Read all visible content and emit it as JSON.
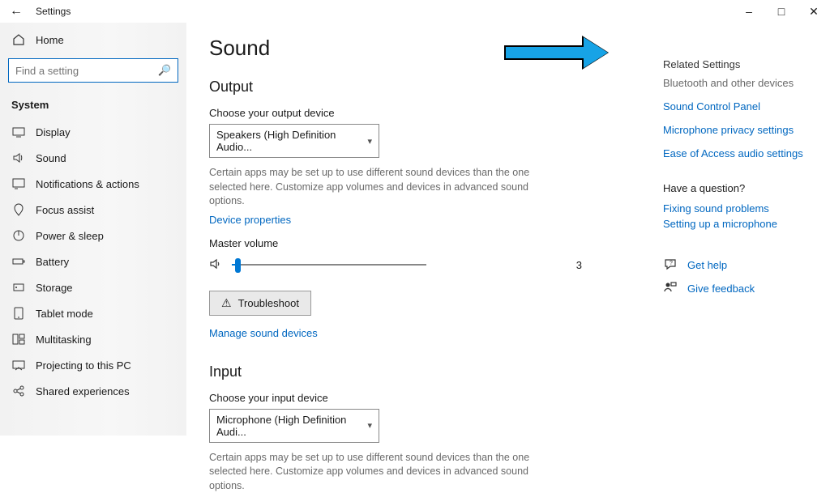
{
  "titlebar": {
    "title": "Settings"
  },
  "sidebar": {
    "home": "Home",
    "search_placeholder": "Find a setting",
    "section": "System",
    "items": [
      {
        "label": "Display"
      },
      {
        "label": "Sound"
      },
      {
        "label": "Notifications & actions"
      },
      {
        "label": "Focus assist"
      },
      {
        "label": "Power & sleep"
      },
      {
        "label": "Battery"
      },
      {
        "label": "Storage"
      },
      {
        "label": "Tablet mode"
      },
      {
        "label": "Multitasking"
      },
      {
        "label": "Projecting to this PC"
      },
      {
        "label": "Shared experiences"
      }
    ]
  },
  "main": {
    "page_title": "Sound",
    "output": {
      "heading": "Output",
      "choose_label": "Choose your output device",
      "device": "Speakers (High Definition Audio...",
      "desc": "Certain apps may be set up to use different sound devices than the one selected here. Customize app volumes and devices in advanced sound options.",
      "device_properties": "Device properties",
      "master_label": "Master volume",
      "volume_value": "3",
      "volume_percent": 3,
      "troubleshoot": "Troubleshoot",
      "manage": "Manage sound devices"
    },
    "input": {
      "heading": "Input",
      "choose_label": "Choose your input device",
      "device": "Microphone (High Definition Audi...",
      "desc": "Certain apps may be set up to use different sound devices than the one selected here. Customize app volumes and devices in advanced sound options."
    }
  },
  "related": {
    "heading": "Related Settings",
    "sub": "Bluetooth and other devices",
    "links": [
      "Sound Control Panel",
      "Microphone privacy settings",
      "Ease of Access audio settings"
    ],
    "question": "Have a question?",
    "qlinks": [
      "Fixing sound problems",
      "Setting up a microphone"
    ],
    "get_help": "Get help",
    "give_feedback": "Give feedback"
  }
}
